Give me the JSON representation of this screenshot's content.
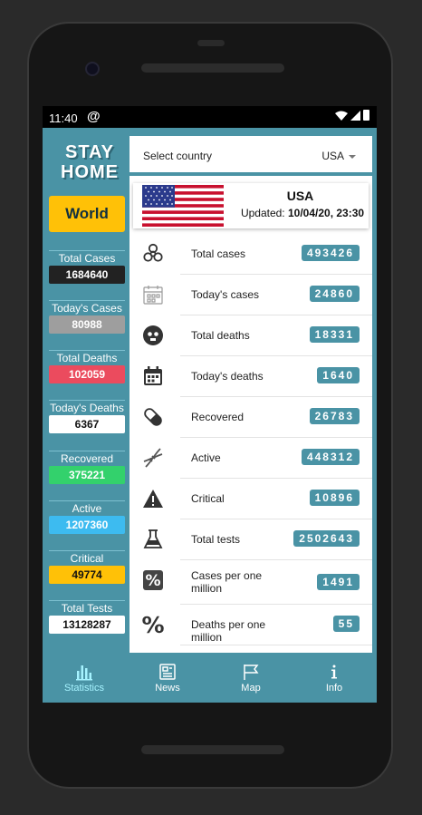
{
  "status": {
    "time": "11:40"
  },
  "logo": {
    "line1": "STAY",
    "line2": "HOME"
  },
  "world_button": "World",
  "left_stats": [
    {
      "label": "Total Cases",
      "value": "1684640",
      "bg": "#222222",
      "fg": "#ffffff"
    },
    {
      "label": "Today's Cases",
      "value": "80988",
      "bg": "#9e9e9e",
      "fg": "#ffffff"
    },
    {
      "label": "Total Deaths",
      "value": "102059",
      "bg": "#EB4B5E",
      "fg": "#ffffff"
    },
    {
      "label": "Today's Deaths",
      "value": "6367",
      "bg": "#ffffff",
      "fg": "#111111"
    },
    {
      "label": "Recovered",
      "value": "375221",
      "bg": "#33D16C",
      "fg": "#ffffff"
    },
    {
      "label": "Active",
      "value": "1207360",
      "bg": "#3DBBF0",
      "fg": "#ffffff"
    },
    {
      "label": "Critical",
      "value": "49774",
      "bg": "#FFC107",
      "fg": "#111111"
    },
    {
      "label": "Total Tests",
      "value": "13128287",
      "bg": "#ffffff",
      "fg": "#111111"
    }
  ],
  "select": {
    "label": "Select country",
    "value": "USA"
  },
  "country": {
    "name": "USA",
    "updated_label": "Updated:",
    "updated_value": "10/04/20, 23:30"
  },
  "rows": [
    {
      "icon": "biohazard-icon",
      "label": "Total cases",
      "value": "493426"
    },
    {
      "icon": "calendar-outline-icon",
      "label": "Today's cases",
      "value": "24860"
    },
    {
      "icon": "skull-icon",
      "label": "Total deaths",
      "value": "18331"
    },
    {
      "icon": "calendar-icon",
      "label": "Today's deaths",
      "value": "1640"
    },
    {
      "icon": "pill-icon",
      "label": "Recovered",
      "value": "26783"
    },
    {
      "icon": "dna-icon",
      "label": "Active",
      "value": "448312"
    },
    {
      "icon": "warning-icon",
      "label": "Critical",
      "value": "10896"
    },
    {
      "icon": "flask-icon",
      "label": "Total tests",
      "value": "2502643"
    },
    {
      "icon": "percent-box-icon",
      "label": "Cases per one million",
      "value": "1491"
    },
    {
      "icon": "percent-icon",
      "label": "Deaths per one million",
      "value": "55"
    }
  ],
  "nav": [
    {
      "label": "Statistics",
      "icon": "bar-chart-icon",
      "active": true
    },
    {
      "label": "News",
      "icon": "newspaper-icon",
      "active": false
    },
    {
      "label": "Map",
      "icon": "flag-icon",
      "active": false
    },
    {
      "label": "Info",
      "icon": "info-icon",
      "active": false
    }
  ],
  "colors": {
    "accent": "#4A93A5",
    "world_button": "#FFC107"
  }
}
